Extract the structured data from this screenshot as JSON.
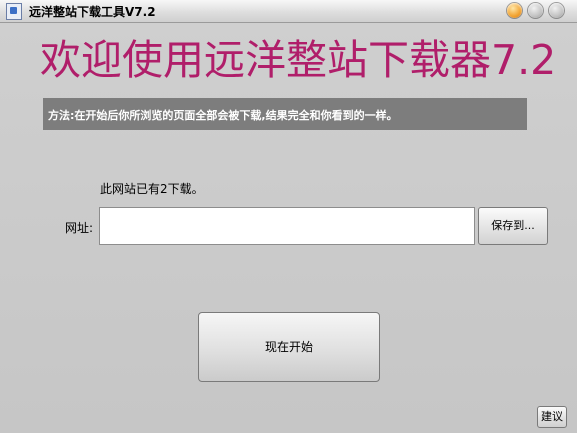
{
  "window": {
    "title": "远洋整站下载工具V7.2",
    "icon": "app-icon"
  },
  "main": {
    "headline": "欢迎使用远洋整站下载器7.2",
    "info_text": "方法:在开始后你所浏览的页面全部会被下载,结果完全和你看到的一样。",
    "download_count_text": "此网站已有2下载。",
    "url_label": "网址:",
    "url_value": "",
    "save_button": "保存到...",
    "start_button": "现在开始",
    "suggest_button": "建议"
  },
  "colors": {
    "headline": "#b01e6a",
    "info_bar_bg": "#7d7d7d",
    "background": "#c8c8c8"
  }
}
